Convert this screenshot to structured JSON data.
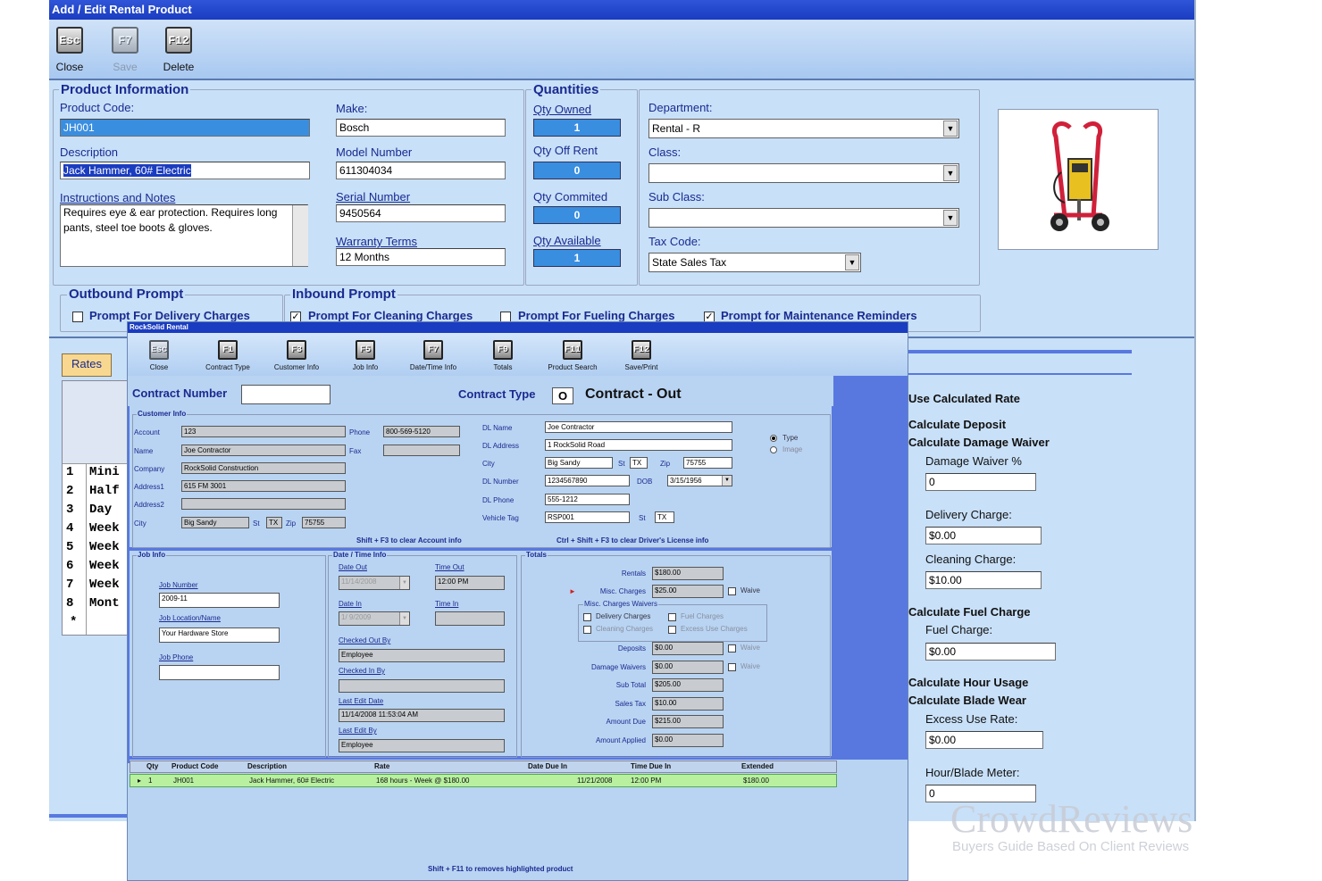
{
  "back": {
    "title": "Add / Edit Rental Product",
    "toolbar": [
      {
        "key": "Esc",
        "label": "Close"
      },
      {
        "key": "F7",
        "label": "Save"
      },
      {
        "key": "F12",
        "label": "Delete"
      }
    ],
    "product_info": {
      "title": "Product Information",
      "product_code_label": "Product Code:",
      "product_code": "JH001",
      "description_label": "Description",
      "description": "Jack Hammer, 60# Electric",
      "notes_label": "Instructions and Notes",
      "notes": "Requires eye & ear protection. Requires long pants, steel toe boots & gloves.",
      "make_label": "Make:",
      "make": "Bosch",
      "model_label": "Model Number",
      "model": "611304034",
      "serial_label": "Serial Number",
      "serial": "9450564",
      "warranty_label": "Warranty Terms",
      "warranty": "12 Months"
    },
    "quantities": {
      "title": "Quantities",
      "owned_label": "Qty Owned",
      "owned": "1",
      "offrent_label": "Qty Off Rent",
      "offrent": "0",
      "committed_label": "Qty Commited",
      "committed": "0",
      "available_label": "Qty Available",
      "available": "1"
    },
    "classification": {
      "department_label": "Department:",
      "department": "Rental - R",
      "class_label": "Class:",
      "class": "",
      "subclass_label": "Sub Class:",
      "subclass": "",
      "taxcode_label": "Tax Code:",
      "taxcode": "State Sales Tax"
    },
    "outbound": {
      "title": "Outbound Prompt",
      "delivery": "Prompt For Delivery Charges"
    },
    "inbound": {
      "title": "Inbound Prompt",
      "cleaning": "Prompt For Cleaning Charges",
      "fueling": "Prompt For Fueling Charges",
      "maintenance": "Prompt for Maintenance Reminders"
    },
    "rates_tab": "Rates",
    "rates_rows": [
      {
        "n": "1",
        "t": "Mini"
      },
      {
        "n": "2",
        "t": "Half"
      },
      {
        "n": "3",
        "t": "Day"
      },
      {
        "n": "4",
        "t": "Week"
      },
      {
        "n": "5",
        "t": "Week"
      },
      {
        "n": "6",
        "t": "Week"
      },
      {
        "n": "7",
        "t": "Week"
      },
      {
        "n": "8",
        "t": "Mont"
      }
    ],
    "rates_new_marker": "*",
    "right": {
      "use_calc_rate": "Use Calculated Rate",
      "calc_deposit": "Calculate Deposit",
      "calc_damage": "Calculate Damage Waiver",
      "damage_pct_label": "Damage Waiver %",
      "damage_pct": "0",
      "delivery_label": "Delivery Charge:",
      "delivery": "$0.00",
      "cleaning_label": "Cleaning Charge:",
      "cleaning": "$10.00",
      "calc_fuel": "Calculate Fuel Charge",
      "fuel_label": "Fuel Charge:",
      "fuel": "$0.00",
      "calc_hour": "Calculate Hour Usage",
      "calc_blade": "Calculate Blade Wear",
      "excess_label": "Excess Use Rate:",
      "excess": "$0.00",
      "meter_label": "Hour/Blade Meter:",
      "meter": "0"
    }
  },
  "front": {
    "title": "RockSolid Rental",
    "toolbar": [
      {
        "key": "Esc",
        "label": "Close"
      },
      {
        "key": "F1",
        "label": "Contract Type"
      },
      {
        "key": "F3",
        "label": "Customer Info"
      },
      {
        "key": "F5",
        "label": "Job Info"
      },
      {
        "key": "F7",
        "label": "Date/Time Info"
      },
      {
        "key": "F9",
        "label": "Totals"
      },
      {
        "key": "F11",
        "label": "Product Search"
      },
      {
        "key": "F12",
        "label": "Save/Print"
      }
    ],
    "contract_number_label": "Contract Number",
    "contract_number": "",
    "contract_type_label": "Contract Type",
    "contract_type_code": "O",
    "contract_type": "Contract - Out",
    "customer": {
      "title": "Customer Info",
      "account_label": "Account",
      "account": "123",
      "name_label": "Name",
      "name": "Joe Contractor",
      "company_label": "Company",
      "company": "RockSolid Construction",
      "address1_label": "Address1",
      "address1": "615 FM 3001",
      "address2_label": "Address2",
      "address2": "",
      "city_label": "City",
      "city": "Big Sandy",
      "st_label": "St",
      "st": "TX",
      "zip_label": "Zip",
      "zip": "75755",
      "phone_label": "Phone",
      "phone": "800-569-5120",
      "fax_label": "Fax",
      "fax": "",
      "dl_name_label": "DL Name",
      "dl_name": "Joe Contractor",
      "dl_address_label": "DL Address",
      "dl_address": "1 RockSolid Road",
      "dl_city_label": "City",
      "dl_city": "Big Sandy",
      "dl_st": "TX",
      "dl_zip": "75755",
      "dl_number_label": "DL Number",
      "dl_number": "1234567890",
      "dob_label": "DOB",
      "dob": "3/15/1956",
      "dl_phone_label": "DL Phone",
      "dl_phone": "555-1212",
      "vehicle_label": "Vehicle Tag",
      "vehicle": "RSP001",
      "vehicle_st": "TX",
      "radio_type": "Type",
      "radio_image": "Image",
      "hint_left": "Shift + F3 to clear Account info",
      "hint_right": "Ctrl + Shift + F3 to clear Driver's License info"
    },
    "job": {
      "title": "Job Info",
      "number_label": "Job Number",
      "number": "2009-11",
      "location_label": "Job Location/Name",
      "location": "Your Hardware Store",
      "phone_label": "Job Phone",
      "phone": ""
    },
    "datetime": {
      "title": "Date / Time Info",
      "date_out_label": "Date Out",
      "date_out": "11/14/2008",
      "time_out_label": "Time Out",
      "time_out": "12:00 PM",
      "date_in_label": "Date In",
      "date_in": "1/ 9/2009",
      "time_in_label": "Time In",
      "time_in": "",
      "checked_out_label": "Checked Out By",
      "checked_out": "Employee",
      "checked_in_label": "Checked In By",
      "checked_in": "",
      "last_edit_date_label": "Last Edit Date",
      "last_edit_date": "11/14/2008 11:53:04 AM",
      "last_edit_by_label": "Last Edit By",
      "last_edit_by": "Employee"
    },
    "totals": {
      "title": "Totals",
      "rentals_label": "Rentals",
      "rentals": "$180.00",
      "misc_label": "Misc. Charges",
      "misc": "$25.00",
      "waive": "Waive",
      "waivers_title": "Misc. Charges Waivers",
      "w_delivery": "Delivery Charges",
      "w_fuel": "Fuel Charges",
      "w_cleaning": "Cleaning Charges",
      "w_excess": "Excess Use Charges",
      "deposits_label": "Deposits",
      "deposits": "$0.00",
      "damage_label": "Damage Waivers",
      "damage": "$0.00",
      "subtotal_label": "Sub Total",
      "subtotal": "$205.00",
      "tax_label": "Sales Tax",
      "tax": "$10.00",
      "due_label": "Amount Due",
      "due": "$215.00",
      "applied_label": "Amount Applied",
      "applied": "$0.00"
    },
    "grid": {
      "headers": [
        "Qty",
        "Product Code",
        "Description",
        "Rate",
        "Date Due In",
        "Time Due In",
        "Extended"
      ],
      "row": {
        "marker": "▸",
        "qty": "1",
        "code": "JH001",
        "desc": "Jack Hammer, 60# Electric",
        "rate": "168 hours - Week @ $180.00",
        "date": "11/21/2008",
        "time": "12:00 PM",
        "ext": "$180.00"
      }
    },
    "footer_hint": "Shift + F11 to removes highlighted product"
  },
  "watermark": {
    "brand": "CrowdReviews",
    "tagline": "Buyers Guide Based On Client Reviews"
  }
}
